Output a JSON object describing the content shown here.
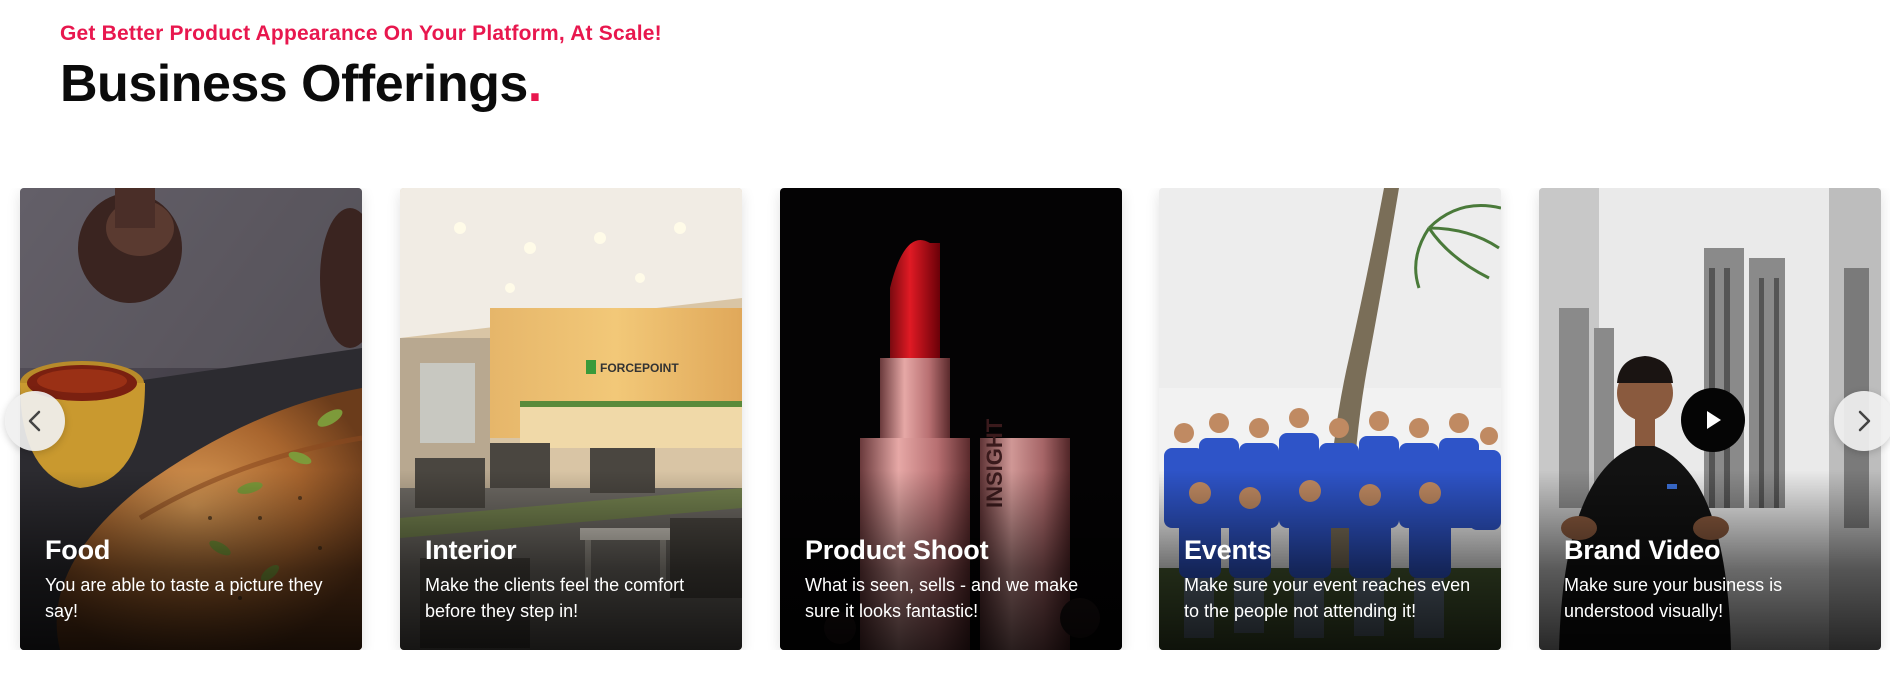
{
  "header": {
    "eyebrow": "Get Better Product Appearance On Your Platform, At Scale!",
    "title": "Business Offerings",
    "title_dot": "."
  },
  "colors": {
    "accent": "#e8174e",
    "text": "#0b0b0b"
  },
  "cards": [
    {
      "title": "Food",
      "description": "You are able to taste a picture they say!",
      "image": "food-photo"
    },
    {
      "title": "Interior",
      "description": "Make the clients feel the comfort before they step in!",
      "image": "office-interior-photo",
      "sign": "FORCEPOINT"
    },
    {
      "title": "Product Shoot",
      "description": "What is seen, sells - and we make sure it looks fantastic!",
      "image": "lipstick-photo",
      "brand": "INSIGHT"
    },
    {
      "title": "Events",
      "description": "Make sure your event reaches even to the people not attending it!",
      "image": "group-event-photo"
    },
    {
      "title": "Brand Video",
      "description": "Make sure your business is understood visually!",
      "image": "presenter-video-thumbnail"
    }
  ],
  "controls": {
    "prev_icon": "chevron-left-icon",
    "next_icon": "chevron-right-icon",
    "play_icon": "play-icon"
  }
}
